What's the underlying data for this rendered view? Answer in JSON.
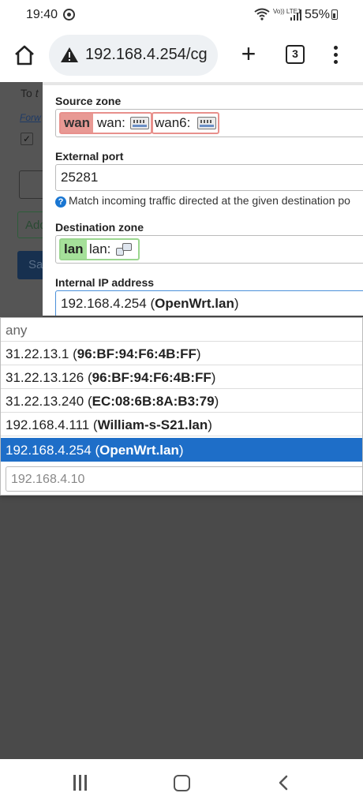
{
  "status_bar": {
    "time": "19:40",
    "volte_label": "Vo)) LTE1",
    "battery": "55%"
  },
  "browser": {
    "url": "192.168.4.254/cg",
    "tab_count": "3",
    "new_tab_label": "+"
  },
  "background_page": {
    "to_label": "To",
    "forward_link": "Forw",
    "add_button": "Add",
    "save_button": "Sa"
  },
  "form": {
    "source_zone": {
      "label": "Source zone",
      "zone_name": "wan",
      "devices": [
        "wan:",
        "wan6:"
      ]
    },
    "external_port": {
      "label": "External port",
      "value": "25281",
      "help": "Match incoming traffic directed at the given destination po"
    },
    "destination_zone": {
      "label": "Destination zone",
      "zone_name": "lan",
      "devices": [
        "lan:"
      ]
    },
    "internal_ip": {
      "label": "Internal IP address",
      "value_ip": "192.168.4.254",
      "value_host": "OpenWrt.lan"
    }
  },
  "dropdown": {
    "items": [
      {
        "ip": "any",
        "host": ""
      },
      {
        "ip": "31.22.13.1",
        "host": "96:BF:94:F6:4B:FF"
      },
      {
        "ip": "31.22.13.126",
        "host": "96:BF:94:F6:4B:FF"
      },
      {
        "ip": "31.22.13.240",
        "host": "EC:08:6B:8A:B3:79"
      },
      {
        "ip": "192.168.4.111",
        "host": "William-s-S21.lan"
      },
      {
        "ip": "192.168.4.254",
        "host": "OpenWrt.lan"
      }
    ],
    "selected_index": 5,
    "custom_placeholder": "192.168.4.10"
  },
  "colors": {
    "wan_zone": "#e89994",
    "lan_zone": "#a5e09a",
    "selected": "#1e6ec8"
  }
}
